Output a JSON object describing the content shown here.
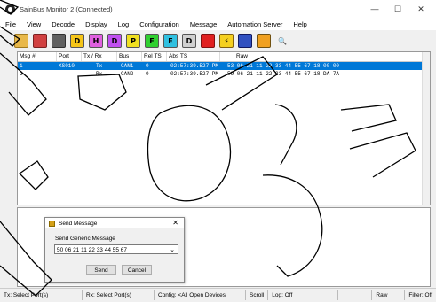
{
  "window": {
    "title": "SainBus Monitor 2 (Connected)",
    "minimize": "—",
    "maximize": "☐",
    "close": "✕"
  },
  "menu": [
    "File",
    "View",
    "Decode",
    "Display",
    "Log",
    "Configuration",
    "Message",
    "Automation Server",
    "Help"
  ],
  "toolbar": {
    "buttons": [
      {
        "name": "open-folder-icon",
        "glyph": "",
        "bg": "#e8b84a",
        "border": "#a07a20"
      },
      {
        "name": "color-config-icon",
        "glyph": "",
        "bg": "#d04040",
        "border": "#7a2020"
      },
      {
        "name": "filter-icon",
        "glyph": "",
        "bg": "#606060",
        "border": "#303030"
      },
      {
        "name": "letter-d-button",
        "glyph": "D",
        "bg": "#f5c518",
        "border": "#555"
      },
      {
        "name": "letter-h-button",
        "glyph": "H",
        "bg": "#e060e0",
        "border": "#555"
      },
      {
        "name": "letter-d2-button",
        "glyph": "D",
        "bg": "#c050f0",
        "border": "#555"
      },
      {
        "name": "letter-p-button",
        "glyph": "P",
        "bg": "#f0e020",
        "border": "#555"
      },
      {
        "name": "letter-f-button",
        "glyph": "F",
        "bg": "#30d030",
        "border": "#555"
      },
      {
        "name": "letter-e-button",
        "glyph": "E",
        "bg": "#30c0e0",
        "border": "#555"
      },
      {
        "name": "letter-d3-button",
        "glyph": "D",
        "bg": "#d0d0d0",
        "border": "#555"
      },
      {
        "name": "record-icon",
        "glyph": "",
        "bg": "#e02020",
        "border": "#801010"
      },
      {
        "name": "lightning-icon",
        "glyph": "⚡",
        "bg": "#f5d020",
        "border": "#806010"
      },
      {
        "name": "monitor-icon",
        "glyph": "",
        "bg": "#3050c0",
        "border": "#101860"
      },
      {
        "name": "chart-icon",
        "glyph": "",
        "bg": "#f0a020",
        "border": "#705010"
      },
      {
        "name": "search-icon",
        "glyph": "🔍",
        "bg": "transparent",
        "border": "transparent"
      }
    ]
  },
  "grid": {
    "columns": [
      "Msg #",
      "Port",
      "Tx / Rx",
      "Bus",
      "Rel TS",
      "Abs TS",
      "Raw"
    ],
    "rows": [
      {
        "msg": "1",
        "port": "XS010",
        "txrx": "Tx",
        "bus": "CAN1",
        "rel": "0",
        "abs": "02:57:39.527 PM",
        "raw": "53 06 21 11 22 33 44 55 67 18 00 00"
      },
      {
        "msg": "2",
        "port": "",
        "txrx": "Rx",
        "bus": "CAN2",
        "rel": "0",
        "abs": "02:57:39.527 PM",
        "raw": "59 06 21 11 22 33 44 55 67 18 DA 7A"
      }
    ]
  },
  "dialog": {
    "title": "Send Message",
    "close": "✕",
    "label": "Send Generic Message",
    "value": "50 06 21 11 22 33 44 55 67",
    "send": "Send",
    "cancel": "Cancel"
  },
  "status": {
    "tx": "Tx: Select Port(s)",
    "rx": "Rx: Select Port(s)",
    "config": "Config: <All Open Devices",
    "scroll": "Scroll",
    "log": "Log: Off",
    "raw": "Raw",
    "filter": "Filter: Off"
  }
}
